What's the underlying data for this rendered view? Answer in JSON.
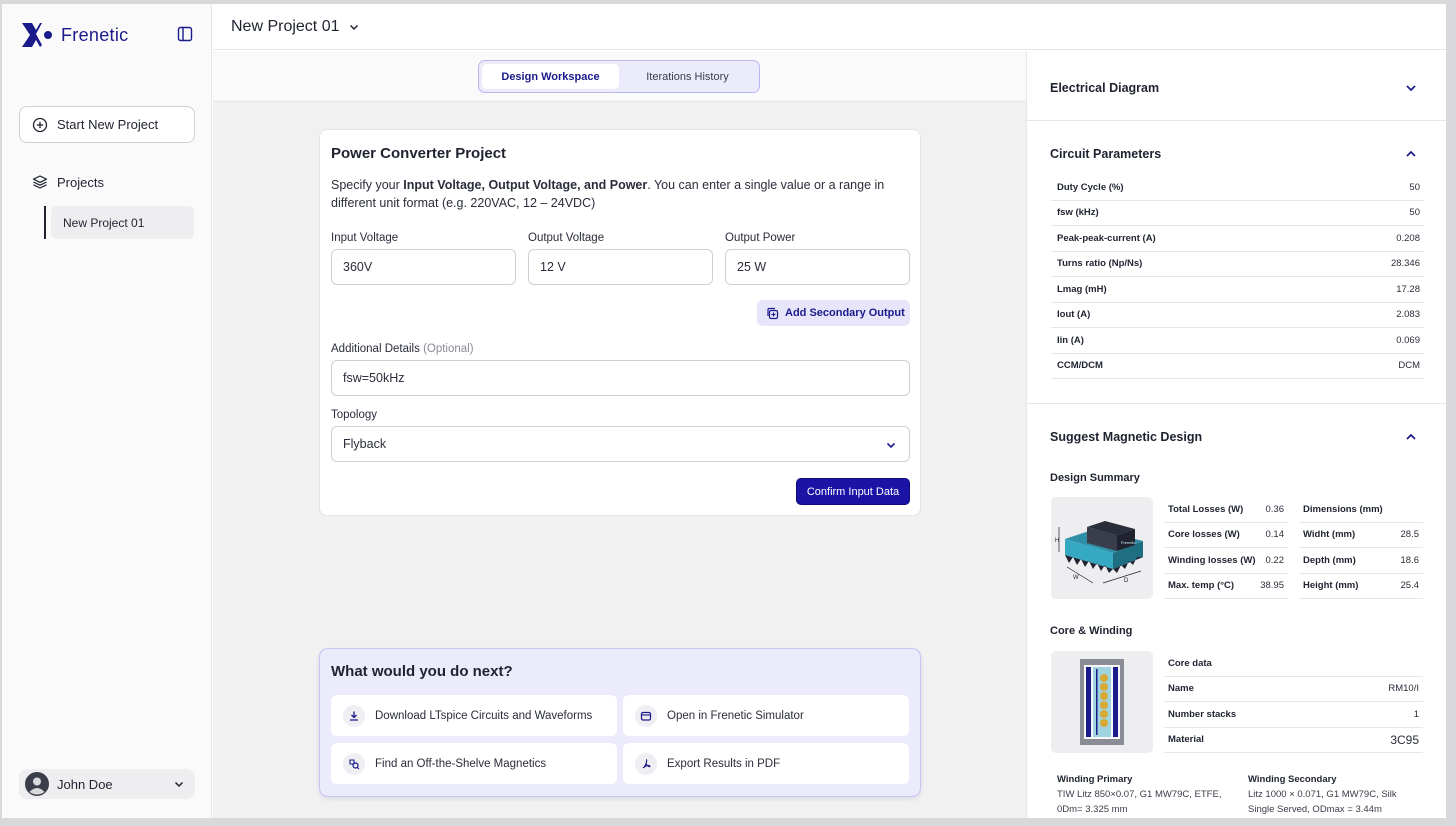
{
  "brand": {
    "name": "Frenetic"
  },
  "sidebar": {
    "new_project_label": "Start New Project",
    "projects_label": "Projects",
    "projects": [
      {
        "label": "New Project 01"
      }
    ],
    "user_name": "John Doe"
  },
  "header": {
    "project_title": "New Project 01"
  },
  "tabs": [
    {
      "label": "Design Workspace",
      "active": true
    },
    {
      "label": "Iterations History",
      "active": false
    }
  ],
  "form": {
    "title": "Power Converter Project",
    "desc_pre": "Specify your ",
    "desc_bold": "Input Voltage, Output Voltage, and Power",
    "desc_post": ". You can enter a single value or a range in different unit format (e.g. 220VAC, 12 – 24VDC)",
    "input_voltage_label": "Input Voltage",
    "input_voltage_value": "360V",
    "output_voltage_label": "Output Voltage",
    "output_voltage_value": "12 V",
    "output_power_label": "Output Power",
    "output_power_value": "25 W",
    "add_secondary_label": "Add Secondary Output",
    "details_label": "Additional Details",
    "details_optional": "(Optional)",
    "details_value": "fsw=50kHz",
    "topology_label": "Topology",
    "topology_value": "Flyback",
    "confirm_label": "Confirm Input Data"
  },
  "next": {
    "title": "What would you do next?",
    "actions": [
      {
        "label": "Download LTspice Circuits and Waveforms",
        "icon": "download-icon"
      },
      {
        "label": "Open in Frenetic Simulator",
        "icon": "simulator-icon"
      },
      {
        "label": "Find an Off-the-Shelve Magnetics",
        "icon": "search-magnet-icon"
      },
      {
        "label": "Export Results in PDF",
        "icon": "pdf-icon"
      }
    ]
  },
  "panel": {
    "electrical_title": "Electrical Diagram",
    "circuit_title": "Circuit Parameters",
    "circuit_params": [
      {
        "k": "Duty Cycle (%)",
        "v": "50"
      },
      {
        "k": "fsw (kHz)",
        "v": "50"
      },
      {
        "k": "Peak-peak-current (A)",
        "v": "0.208"
      },
      {
        "k": "Turns ratio (Np/Ns)",
        "v": "28.346"
      },
      {
        "k": "Lmag (mH)",
        "v": "17.28"
      },
      {
        "k": "Iout (A)",
        "v": "2.083"
      },
      {
        "k": "Iin (A)",
        "v": "0.069"
      },
      {
        "k": "CCM/DCM",
        "v": "DCM"
      }
    ],
    "magnetic_title": "Suggest Magnetic Design",
    "summary_title": "Design Summary",
    "losses": [
      {
        "k": "Total Losses (W)",
        "v": "0.36"
      },
      {
        "k": "Core losses (W)",
        "v": "0.14"
      },
      {
        "k": "Winding losses (W)",
        "v": "0.22"
      },
      {
        "k": "Max. temp (°C)",
        "v": "38.95"
      }
    ],
    "dims": [
      {
        "k": "Dimensions (mm)",
        "v": ""
      },
      {
        "k": "Widht (mm)",
        "v": "28.5"
      },
      {
        "k": "Depth (mm)",
        "v": "18.6"
      },
      {
        "k": "Height (mm)",
        "v": "25.4"
      }
    ],
    "core_title": "Core & Winding",
    "core": [
      {
        "k": "Core data",
        "v": ""
      },
      {
        "k": "Name",
        "v": "RM10/I"
      },
      {
        "k": "Number stacks",
        "v": "1"
      },
      {
        "k": "Material",
        "v": "3C95"
      }
    ],
    "winding_primary_title": "Winding Primary",
    "winding_primary_text": "TIW Litz 850×0.07, G1 MW79C, ETFE, 0Dm= 3.325 mm",
    "winding_secondary_title": "Winding Secondary",
    "winding_secondary_text": "Litz 1000 × 0.071, G1 MW79C, Silk Single Served, ODmax = 3.44m",
    "dim_labels": {
      "h": "H",
      "w": "W",
      "d": "D"
    }
  },
  "colors": {
    "accent": "#1b13a6",
    "accent_light": "#ecebfb",
    "brand": "#1b1a8a",
    "teal": "#35a9c2"
  }
}
